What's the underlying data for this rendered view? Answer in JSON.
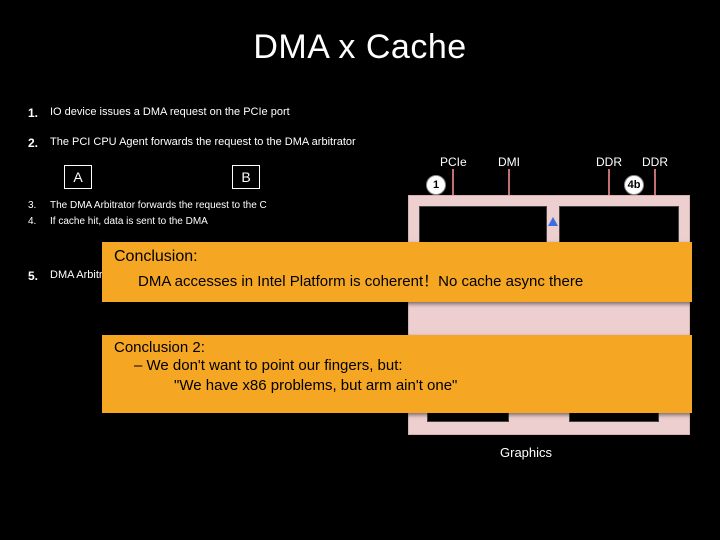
{
  "title": "DMA x Cache",
  "steps": {
    "s1": {
      "num": "1.",
      "text": "IO device issues a DMA request on the PCIe port"
    },
    "s2": {
      "num": "2.",
      "text": "The PCI CPU Agent forwards the request to the DMA arbitrator"
    },
    "s3": {
      "num": "3.",
      "text": "The DMA Arbitrator forwards the request to the C"
    },
    "s4": {
      "num": "4.",
      "text": "If cache hit, data is sent to the DMA"
    },
    "s5": {
      "num": "5.",
      "text": "DMA Arbitrator completes the"
    }
  },
  "ab": {
    "a": "A",
    "b": "B"
  },
  "ports": {
    "pcie": "PCIe",
    "dmi": "DMI",
    "ddr1": "DDR",
    "ddr2": "DDR"
  },
  "badges": {
    "one": "1",
    "fourb": "4b"
  },
  "graphics": "Graphics",
  "overlay1": {
    "heading": "Conclusion:",
    "body": "DMA accesses in Intel Platform is coherent！No cache async there"
  },
  "overlay2": {
    "heading": "Conclusion 2:",
    "line1": "–  We don't want to point our fingers, but:",
    "line2": "\"We have x86 problems, but arm ain't one\""
  }
}
